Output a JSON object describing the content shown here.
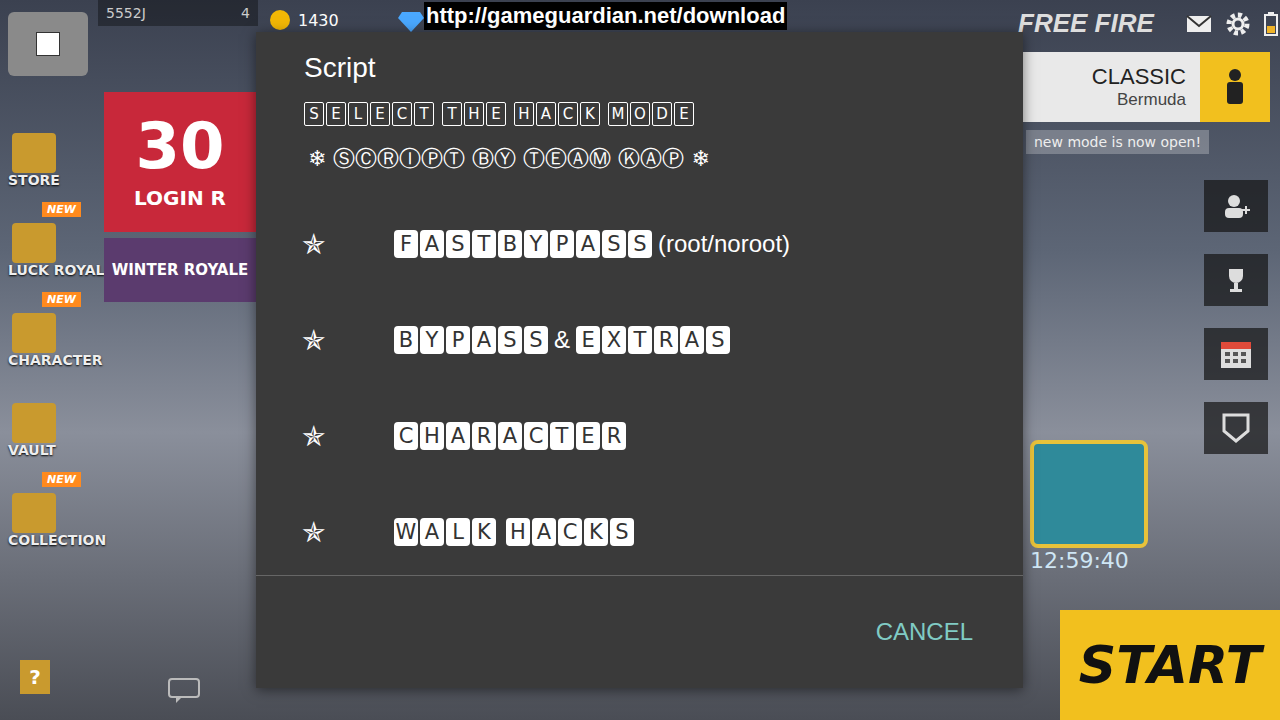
{
  "hud": {
    "player_id": "5552J",
    "level": "4",
    "coins": "1430",
    "url": "http://gameguardian.net/download",
    "logo": "FREE FIRE",
    "mode": {
      "title": "CLASSIC",
      "map": "Bermuda"
    },
    "mode_notice": "new mode is now open!",
    "timer": "12:59:40",
    "start": "START",
    "help": "?"
  },
  "sidebar": [
    {
      "label": "STORE",
      "new": false
    },
    {
      "label": "LUCK ROYALE",
      "new": true
    },
    {
      "label": "CHARACTER",
      "new": true
    },
    {
      "label": "VAULT",
      "new": false
    },
    {
      "label": "COLLECTION",
      "new": true
    }
  ],
  "new_badge": "NEW",
  "banners": {
    "login": {
      "number": "30",
      "text": "LOGIN R"
    },
    "event": "WINTER ROYALE"
  },
  "dialog": {
    "title": "Script",
    "heading": "SELECT THE HACK MODE",
    "credit": "❄ ⓈⒸⓇⒾⓅⓉ ⒷⓎ ⓉⒺⒶⓂ ⓀⒶⓅ ❄",
    "options": [
      {
        "bullet": "✯",
        "parts": [
          {
            "text": "FASTBYPASS",
            "boxed": true
          },
          {
            "text": "(root/noroot)",
            "boxed": false
          }
        ]
      },
      {
        "bullet": "✯",
        "parts": [
          {
            "text": "BYPASS",
            "boxed": true
          },
          {
            "text": "&",
            "boxed": false
          },
          {
            "text": "EXTRAS",
            "boxed": true
          }
        ]
      },
      {
        "bullet": "✯",
        "parts": [
          {
            "text": "CHARACTER",
            "boxed": true
          }
        ]
      },
      {
        "bullet": "✯",
        "parts": [
          {
            "text": "WALK HACKS",
            "boxed": true
          }
        ]
      }
    ],
    "buttons": [
      "CANCEL"
    ]
  }
}
